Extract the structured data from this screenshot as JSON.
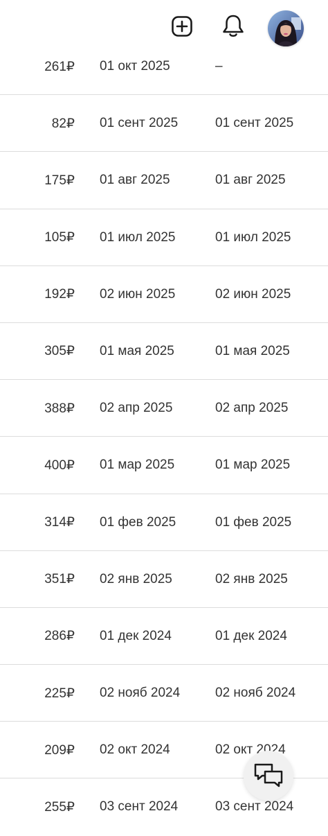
{
  "header": {
    "add_icon": "add-square-icon",
    "bell_icon": "bell-icon",
    "avatar_alt": "user avatar"
  },
  "rows": [
    {
      "amount": "261₽",
      "date_a": "01 окт 2025",
      "date_b": "–"
    },
    {
      "amount": "82₽",
      "date_a": "01 сент 2025",
      "date_b": "01 сент 2025"
    },
    {
      "amount": "175₽",
      "date_a": "01 авг 2025",
      "date_b": "01 авг 2025"
    },
    {
      "amount": "105₽",
      "date_a": "01 июл 2025",
      "date_b": "01 июл 2025"
    },
    {
      "amount": "192₽",
      "date_a": "02 июн 2025",
      "date_b": "02 июн 2025"
    },
    {
      "amount": "305₽",
      "date_a": "01 мая 2025",
      "date_b": "01 мая 2025"
    },
    {
      "amount": "388₽",
      "date_a": "02 апр 2025",
      "date_b": "02 апр 2025"
    },
    {
      "amount": "400₽",
      "date_a": "01 мар 2025",
      "date_b": "01 мар 2025"
    },
    {
      "amount": "314₽",
      "date_a": "01 фев 2025",
      "date_b": "01 фев 2025"
    },
    {
      "amount": "351₽",
      "date_a": "02 янв 2025",
      "date_b": "02 янв 2025"
    },
    {
      "amount": "286₽",
      "date_a": "01 дек 2024",
      "date_b": "01 дек 2024"
    },
    {
      "amount": "225₽",
      "date_a": "02 нояб 2024",
      "date_b": "02 нояб 2024"
    },
    {
      "amount": "209₽",
      "date_a": "02 окт 2024",
      "date_b": "02 окт 2024"
    },
    {
      "amount": "255₽",
      "date_a": "03 сент 2024",
      "date_b": "03 сент 2024"
    }
  ],
  "chat_icon": "chat-bubbles-icon"
}
